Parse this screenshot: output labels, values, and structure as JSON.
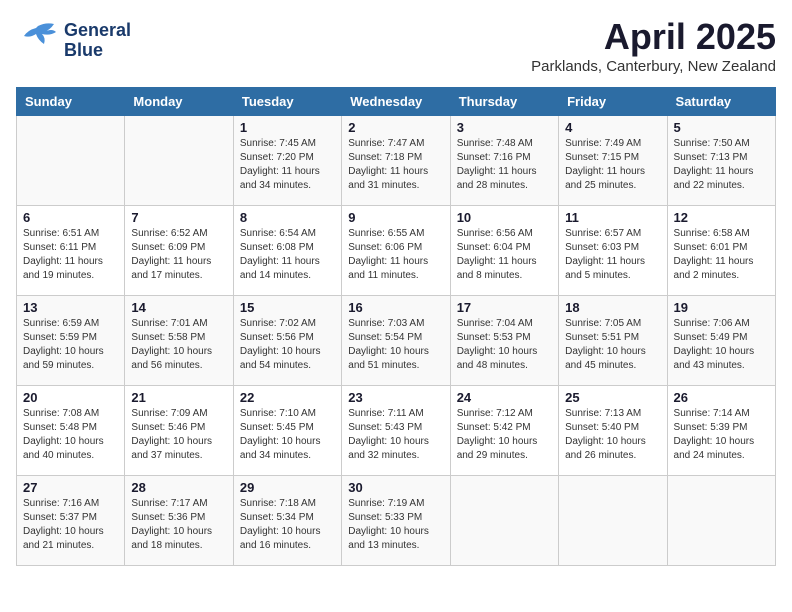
{
  "header": {
    "logo_line1": "General",
    "logo_line2": "Blue",
    "month": "April 2025",
    "location": "Parklands, Canterbury, New Zealand"
  },
  "days_of_week": [
    "Sunday",
    "Monday",
    "Tuesday",
    "Wednesday",
    "Thursday",
    "Friday",
    "Saturday"
  ],
  "weeks": [
    [
      {
        "num": "",
        "info": ""
      },
      {
        "num": "",
        "info": ""
      },
      {
        "num": "1",
        "info": "Sunrise: 7:45 AM\nSunset: 7:20 PM\nDaylight: 11 hours and 34 minutes."
      },
      {
        "num": "2",
        "info": "Sunrise: 7:47 AM\nSunset: 7:18 PM\nDaylight: 11 hours and 31 minutes."
      },
      {
        "num": "3",
        "info": "Sunrise: 7:48 AM\nSunset: 7:16 PM\nDaylight: 11 hours and 28 minutes."
      },
      {
        "num": "4",
        "info": "Sunrise: 7:49 AM\nSunset: 7:15 PM\nDaylight: 11 hours and 25 minutes."
      },
      {
        "num": "5",
        "info": "Sunrise: 7:50 AM\nSunset: 7:13 PM\nDaylight: 11 hours and 22 minutes."
      }
    ],
    [
      {
        "num": "6",
        "info": "Sunrise: 6:51 AM\nSunset: 6:11 PM\nDaylight: 11 hours and 19 minutes."
      },
      {
        "num": "7",
        "info": "Sunrise: 6:52 AM\nSunset: 6:09 PM\nDaylight: 11 hours and 17 minutes."
      },
      {
        "num": "8",
        "info": "Sunrise: 6:54 AM\nSunset: 6:08 PM\nDaylight: 11 hours and 14 minutes."
      },
      {
        "num": "9",
        "info": "Sunrise: 6:55 AM\nSunset: 6:06 PM\nDaylight: 11 hours and 11 minutes."
      },
      {
        "num": "10",
        "info": "Sunrise: 6:56 AM\nSunset: 6:04 PM\nDaylight: 11 hours and 8 minutes."
      },
      {
        "num": "11",
        "info": "Sunrise: 6:57 AM\nSunset: 6:03 PM\nDaylight: 11 hours and 5 minutes."
      },
      {
        "num": "12",
        "info": "Sunrise: 6:58 AM\nSunset: 6:01 PM\nDaylight: 11 hours and 2 minutes."
      }
    ],
    [
      {
        "num": "13",
        "info": "Sunrise: 6:59 AM\nSunset: 5:59 PM\nDaylight: 10 hours and 59 minutes."
      },
      {
        "num": "14",
        "info": "Sunrise: 7:01 AM\nSunset: 5:58 PM\nDaylight: 10 hours and 56 minutes."
      },
      {
        "num": "15",
        "info": "Sunrise: 7:02 AM\nSunset: 5:56 PM\nDaylight: 10 hours and 54 minutes."
      },
      {
        "num": "16",
        "info": "Sunrise: 7:03 AM\nSunset: 5:54 PM\nDaylight: 10 hours and 51 minutes."
      },
      {
        "num": "17",
        "info": "Sunrise: 7:04 AM\nSunset: 5:53 PM\nDaylight: 10 hours and 48 minutes."
      },
      {
        "num": "18",
        "info": "Sunrise: 7:05 AM\nSunset: 5:51 PM\nDaylight: 10 hours and 45 minutes."
      },
      {
        "num": "19",
        "info": "Sunrise: 7:06 AM\nSunset: 5:49 PM\nDaylight: 10 hours and 43 minutes."
      }
    ],
    [
      {
        "num": "20",
        "info": "Sunrise: 7:08 AM\nSunset: 5:48 PM\nDaylight: 10 hours and 40 minutes."
      },
      {
        "num": "21",
        "info": "Sunrise: 7:09 AM\nSunset: 5:46 PM\nDaylight: 10 hours and 37 minutes."
      },
      {
        "num": "22",
        "info": "Sunrise: 7:10 AM\nSunset: 5:45 PM\nDaylight: 10 hours and 34 minutes."
      },
      {
        "num": "23",
        "info": "Sunrise: 7:11 AM\nSunset: 5:43 PM\nDaylight: 10 hours and 32 minutes."
      },
      {
        "num": "24",
        "info": "Sunrise: 7:12 AM\nSunset: 5:42 PM\nDaylight: 10 hours and 29 minutes."
      },
      {
        "num": "25",
        "info": "Sunrise: 7:13 AM\nSunset: 5:40 PM\nDaylight: 10 hours and 26 minutes."
      },
      {
        "num": "26",
        "info": "Sunrise: 7:14 AM\nSunset: 5:39 PM\nDaylight: 10 hours and 24 minutes."
      }
    ],
    [
      {
        "num": "27",
        "info": "Sunrise: 7:16 AM\nSunset: 5:37 PM\nDaylight: 10 hours and 21 minutes."
      },
      {
        "num": "28",
        "info": "Sunrise: 7:17 AM\nSunset: 5:36 PM\nDaylight: 10 hours and 18 minutes."
      },
      {
        "num": "29",
        "info": "Sunrise: 7:18 AM\nSunset: 5:34 PM\nDaylight: 10 hours and 16 minutes."
      },
      {
        "num": "30",
        "info": "Sunrise: 7:19 AM\nSunset: 5:33 PM\nDaylight: 10 hours and 13 minutes."
      },
      {
        "num": "",
        "info": ""
      },
      {
        "num": "",
        "info": ""
      },
      {
        "num": "",
        "info": ""
      }
    ]
  ]
}
